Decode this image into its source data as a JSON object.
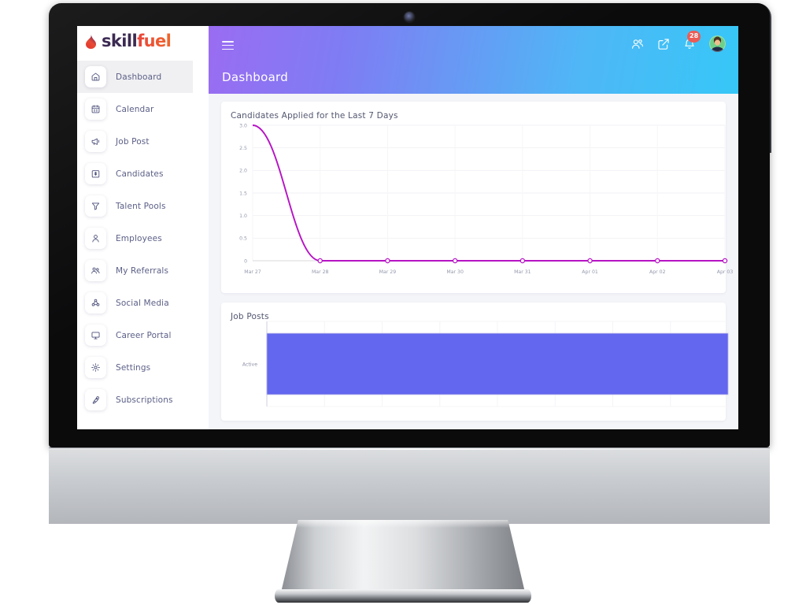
{
  "brand": {
    "name_part1": "skill",
    "name_part2": "fuel",
    "flame_icon": "flame-icon"
  },
  "sidebar": {
    "items": [
      {
        "label": "Dashboard",
        "icon": "home-icon",
        "active": true,
        "chevron": ""
      },
      {
        "label": "Calendar",
        "icon": "calendar-icon",
        "active": false,
        "chevron": ""
      },
      {
        "label": "Job Post",
        "icon": "megaphone-icon",
        "active": false,
        "chevron": ""
      },
      {
        "label": "Candidates",
        "icon": "id-card-icon",
        "active": false,
        "chevron": ""
      },
      {
        "label": "Talent Pools",
        "icon": "filter-icon",
        "active": false,
        "chevron": ""
      },
      {
        "label": "Employees",
        "icon": "user-icon",
        "active": false,
        "chevron": ""
      },
      {
        "label": "My Referrals",
        "icon": "users-icon",
        "active": false,
        "chevron": ""
      },
      {
        "label": "Social Media",
        "icon": "share-icon",
        "active": false,
        "chevron": "›"
      },
      {
        "label": "Career Portal",
        "icon": "monitor-icon",
        "active": false,
        "chevron": "›"
      },
      {
        "label": "Settings",
        "icon": "gear-icon",
        "active": false,
        "chevron": "›"
      },
      {
        "label": "Subscriptions",
        "icon": "rocket-icon",
        "active": false,
        "chevron": "›"
      }
    ]
  },
  "topbar": {
    "menu_icon": "hamburger-icon",
    "page_title": "Dashboard",
    "actions": [
      {
        "icon": "users-add-icon",
        "badge": ""
      },
      {
        "icon": "external-link-icon",
        "badge": ""
      },
      {
        "icon": "notification-bell-icon",
        "badge": "28"
      }
    ],
    "avatar": "user-avatar",
    "gradient_from": "#9a6cf2",
    "gradient_to": "#36c7f7"
  },
  "cards": {
    "line_card_title": "Candidates Applied for the Last 7 Days",
    "bar_card_title": "Job Posts"
  },
  "chart_data": [
    {
      "type": "line",
      "title": "Candidates Applied for the Last 7 Days",
      "x": [
        "Mar 27",
        "Mar 28",
        "Mar 29",
        "Mar 30",
        "Mar 31",
        "Apr 01",
        "Apr 02",
        "Apr 03"
      ],
      "series": [
        {
          "name": "Candidates Applied",
          "values": [
            3,
            0,
            0,
            0,
            0,
            0,
            0,
            0
          ],
          "color": "#b613c4"
        }
      ],
      "xlabel": "",
      "ylabel": "",
      "yticks": [
        "0",
        "0.5",
        "1.0",
        "1.5",
        "2.0",
        "2.5",
        "3.0"
      ],
      "ylim": [
        0,
        3
      ],
      "grid": true,
      "legend": "none",
      "markers": true,
      "smooth": true
    },
    {
      "type": "bar",
      "title": "Job Posts",
      "orientation": "horizontal",
      "categories": [
        "Active"
      ],
      "values": [
        1
      ],
      "xlim": [
        0,
        1
      ],
      "color": "#6366ef",
      "grid": true,
      "legend": "none",
      "xlabel": "",
      "ylabel": ""
    }
  ]
}
